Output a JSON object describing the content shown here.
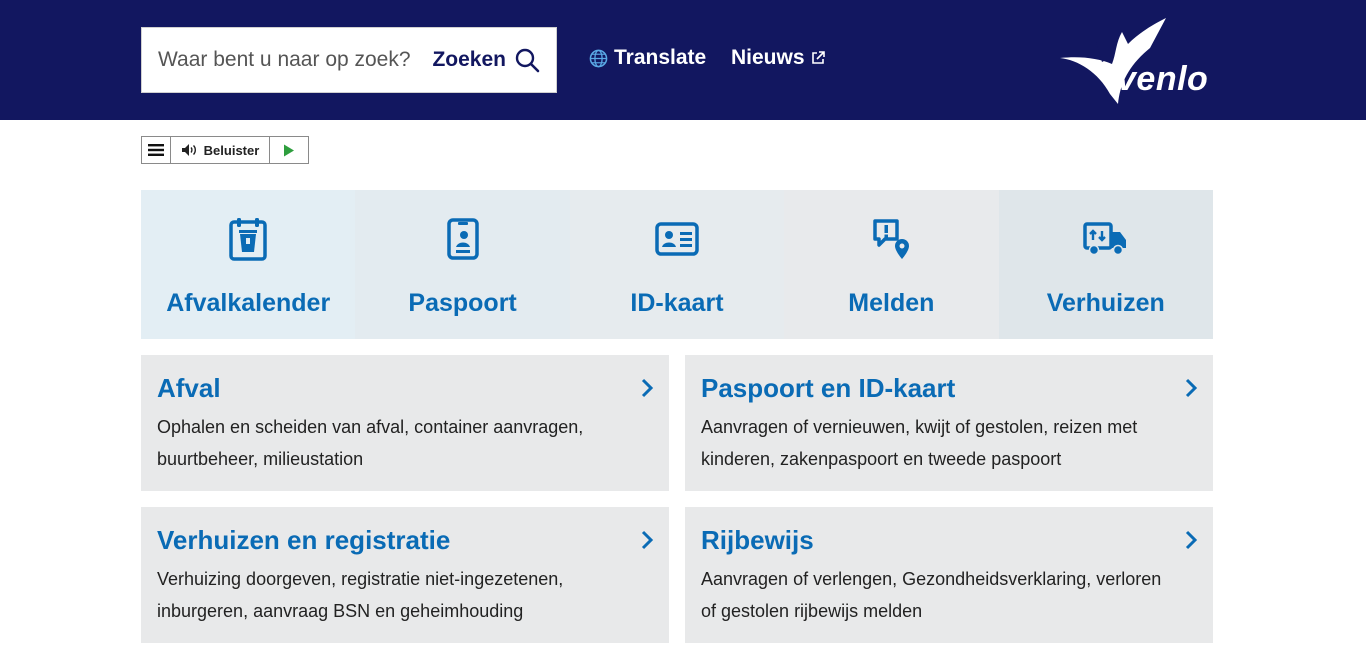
{
  "search": {
    "placeholder": "Waar bent u naar op zoek?",
    "button_label": "Zoeken"
  },
  "nav": {
    "translate_label": "Translate",
    "news_label": "Nieuws"
  },
  "logo": {
    "text": "venlo"
  },
  "readspeaker": {
    "listen_label": "Beluister"
  },
  "tiles": [
    {
      "label": "Afvalkalender",
      "icon": "calendar-bin-icon",
      "bg": "#e3eef4"
    },
    {
      "label": "Paspoort",
      "icon": "passport-icon",
      "bg": "#e3ebf0"
    },
    {
      "label": "ID-kaart",
      "icon": "id-card-icon",
      "bg": "#e6ebee"
    },
    {
      "label": "Melden",
      "icon": "report-location-icon",
      "bg": "#e8eaec"
    },
    {
      "label": "Verhuizen",
      "icon": "moving-truck-icon",
      "bg": "#dfe6ea"
    }
  ],
  "cards": [
    {
      "title": "Afval",
      "description": "Ophalen en scheiden van afval, container aanvragen, buurtbeheer, milieustation"
    },
    {
      "title": "Paspoort en ID-kaart",
      "description": "Aanvragen of vernieuwen, kwijt of gestolen, reizen met kinderen, zakenpaspoort en tweede paspoort"
    },
    {
      "title": "Verhuizen en registratie",
      "description": "Verhuizing doorgeven, registratie niet-ingezetenen, inburgeren, aanvraag BSN en geheimhouding"
    },
    {
      "title": "Rijbewijs",
      "description": "Aanvragen of verlengen, Gezondheidsverklaring, verloren of gestolen rijbewijs melden"
    }
  ],
  "colors": {
    "header_bg": "#121760",
    "accent_blue": "#0a6bb5",
    "card_bg": "#e8e9ea"
  }
}
